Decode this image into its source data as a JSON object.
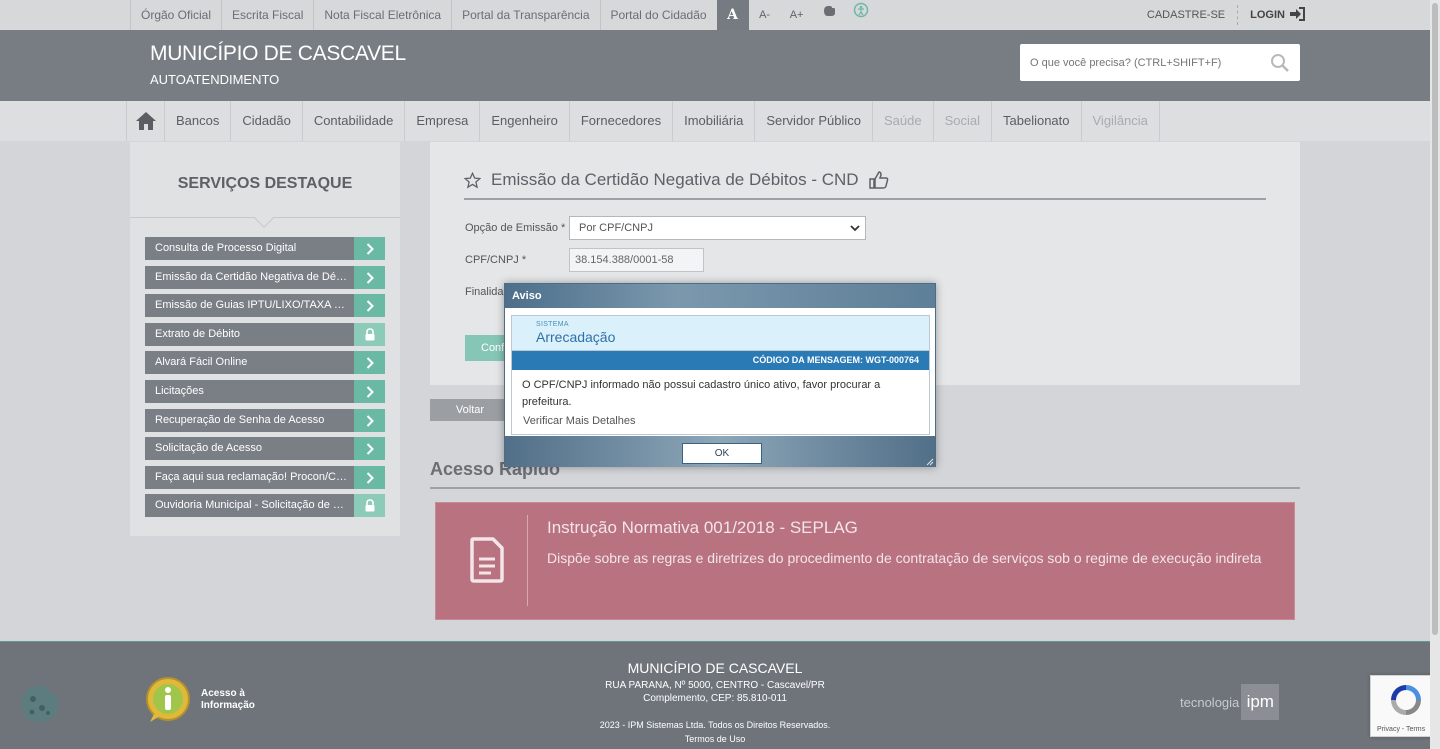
{
  "topbar": {
    "links": [
      "Órgão Oficial",
      "Escrita Fiscal",
      "Nota Fiscal Eletrônica",
      "Portal da Transparência",
      "Portal do Cidadão"
    ],
    "font_normal": "A",
    "font_smaller": "A-",
    "font_larger": "A+",
    "signup": "CADASTRE-SE",
    "login": "LOGIN"
  },
  "header": {
    "title": "MUNICÍPIO DE CASCAVEL",
    "subtitle": "AUTOATENDIMENTO",
    "search_placeholder": "O que você precisa? (CTRL+SHIFT+F)"
  },
  "nav": {
    "items": [
      {
        "label": "Bancos",
        "enabled": true
      },
      {
        "label": "Cidadão",
        "enabled": true
      },
      {
        "label": "Contabilidade",
        "enabled": true
      },
      {
        "label": "Empresa",
        "enabled": true
      },
      {
        "label": "Engenheiro",
        "enabled": true
      },
      {
        "label": "Fornecedores",
        "enabled": true
      },
      {
        "label": "Imobiliária",
        "enabled": true
      },
      {
        "label": "Servidor Público",
        "enabled": true
      },
      {
        "label": "Saúde",
        "enabled": false
      },
      {
        "label": "Social",
        "enabled": false
      },
      {
        "label": "Tabelionato",
        "enabled": true
      },
      {
        "label": "Vigilância",
        "enabled": false
      }
    ]
  },
  "sidebar": {
    "title": "SERVIÇOS DESTAQUE",
    "items": [
      {
        "label": "Consulta de Processo Digital",
        "locked": false
      },
      {
        "label": "Emissão da Certidão Negativa de Débitos",
        "locked": false
      },
      {
        "label": "Emissão de Guias IPTU/LIXO/TAXA DE EXPEDIENTE",
        "locked": false
      },
      {
        "label": "Extrato de Débito",
        "locked": true
      },
      {
        "label": "Alvará Fácil Online",
        "locked": false
      },
      {
        "label": "Licitações",
        "locked": false
      },
      {
        "label": "Recuperação de Senha de Acesso",
        "locked": false
      },
      {
        "label": "Solicitação de Acesso",
        "locked": false
      },
      {
        "label": "Faça aqui sua reclamação! Procon/Cascavel",
        "locked": false
      },
      {
        "label": "Ouvidoria Municipal - Solicitação de Serviços",
        "locked": true
      }
    ]
  },
  "main": {
    "title": "Emissão da Certidão Negativa de Débitos - CND",
    "option_label": "Opção de Emissão *",
    "option_value": "Por CPF/CNPJ",
    "cpf_label": "CPF/CNPJ *",
    "cpf_value": "38.154.388/0001-58",
    "purpose_label": "Finalidade",
    "confirm_label": "Confirmar",
    "back_label": "Voltar"
  },
  "quick": {
    "title": "Acesso Rápido",
    "card_title": "Instrução Normativa 001/2018 - SEPLAG",
    "card_desc": "Dispõe sobre as regras e diretrizes do procedimento de contratação de serviços sob o regime de execução indireta"
  },
  "modal": {
    "title": "Aviso",
    "system_key": "SISTEMA",
    "system_value": "Arrecadação",
    "code": "CÓDIGO DA MENSAGEM: WGT-000764",
    "message": "O CPF/CNPJ informado não possui cadastro único ativo, favor procurar a prefeitura.",
    "details": "Verificar Mais Detalhes",
    "ok": "OK"
  },
  "footer": {
    "name": "MUNICÍPIO DE CASCAVEL",
    "address": "RUA PARANA, Nº 5000, CENTRO - Cascavel/PR",
    "complement": "Complemento, CEP: 85.810-011",
    "copyright": "2023 - IPM Sistemas Ltda. Todos os Direitos Reservados.",
    "terms": "Termos de Uso",
    "info_line1": "Acesso à",
    "info_line2": "Informação",
    "tech": "tecnologia",
    "ipm": "ipm"
  },
  "recaptcha": {
    "text": "Privacy - Terms"
  },
  "colors": {
    "header": "#787c83",
    "accent": "#6ab9a4",
    "card": "#b9727f",
    "modal_code": "#2a7ab5"
  }
}
